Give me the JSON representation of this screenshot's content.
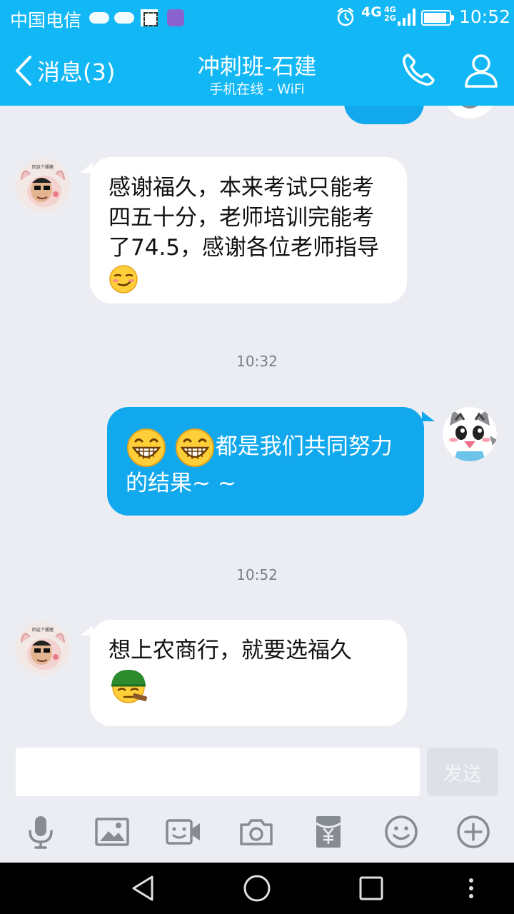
{
  "status_bar": {
    "carrier": "中国电信",
    "network": "4G",
    "signal_label_top": "4G",
    "signal_label_bottom": "2G",
    "time": "10:52"
  },
  "header": {
    "back_label": "消息(3)",
    "title": "冲刺班-石建",
    "subtitle": "手机在线 - WiFi"
  },
  "messages": [
    {
      "direction": "in",
      "text": "感谢福久，本来考试只能考四五十分，老师培训完能考了74.5，感谢各位老师指导",
      "emoji": "smirk-emoji"
    },
    {
      "type": "timestamp",
      "text": "10:32"
    },
    {
      "direction": "out",
      "text": "都是我们共同努力的结果~ ~",
      "emoji": "grin-emoji"
    },
    {
      "type": "timestamp",
      "text": "10:52"
    },
    {
      "direction": "in",
      "text": "想上农商行，就要选福久",
      "emoji": "cigar-emoji"
    }
  ],
  "input": {
    "value": "",
    "send_label": "发送"
  },
  "toolbar": [
    "microphone-icon",
    "image-icon",
    "video-icon",
    "camera-icon",
    "red-packet-icon",
    "emoji-icon",
    "plus-icon"
  ],
  "colors": {
    "brand": "#12b7f5",
    "outgoing_bubble": "#12a8ee",
    "background": "#ebedf2"
  }
}
